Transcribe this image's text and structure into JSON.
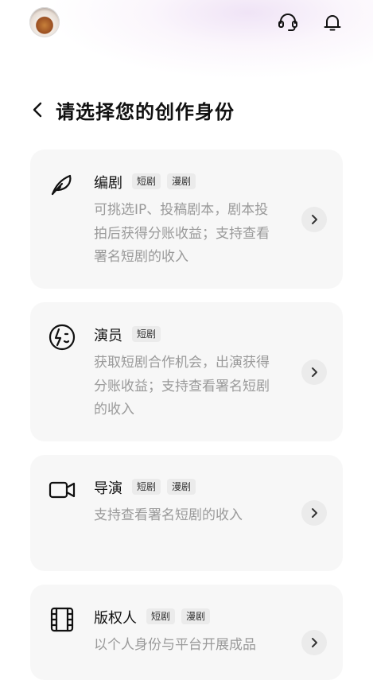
{
  "header": {
    "title": "请选择您的创作身份"
  },
  "cards": [
    {
      "name": "编剧",
      "tags": [
        "短剧",
        "漫剧"
      ],
      "desc": "可挑选IP、投稿剧本，剧本投拍后获得分账收益；支持查看署名短剧的收入",
      "icon": "feather-pen-icon"
    },
    {
      "name": "演员",
      "tags": [
        "短剧"
      ],
      "desc": "获取短剧合作机会，出演获得分账收益；支持查看署名短剧的收入",
      "icon": "actor-face-icon"
    },
    {
      "name": "导演",
      "tags": [
        "短剧",
        "漫剧"
      ],
      "desc": "支持查看署名短剧的收入",
      "icon": "video-camera-icon"
    },
    {
      "name": "版权人",
      "tags": [
        "短剧",
        "漫剧"
      ],
      "desc": "以个人身份与平台开展成品",
      "icon": "film-strip-icon"
    }
  ]
}
